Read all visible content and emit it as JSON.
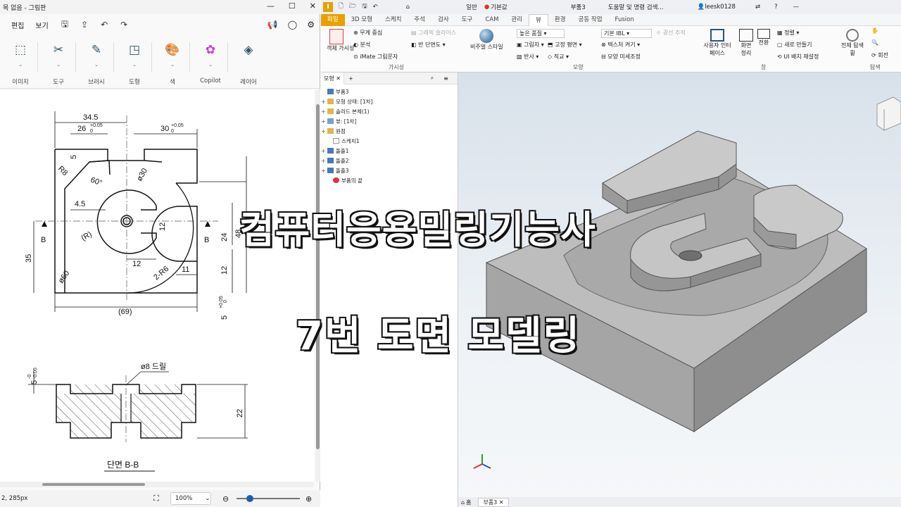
{
  "paint": {
    "window_title": "목 없음 - 그림판",
    "menu": [
      "편집",
      "보기"
    ],
    "ribbon_groups": [
      {
        "label": "이미지",
        "icon": "image-icon"
      },
      {
        "label": "도구",
        "icon": "tools-icon"
      },
      {
        "label": "브러시",
        "icon": "brush-icon"
      },
      {
        "label": "도형",
        "icon": "shapes-icon"
      },
      {
        "label": "색",
        "icon": "palette-icon"
      },
      {
        "label": "Copilot",
        "icon": "copilot-icon"
      },
      {
        "label": "레이어",
        "icon": "layers-icon"
      }
    ],
    "status_pos": "2, 285px",
    "zoom": "100%",
    "drawing": {
      "dims": [
        "34.5",
        "26",
        "+0.05",
        "0",
        "30",
        "+0.05",
        "0",
        "5",
        "R8",
        "60°",
        "ø30",
        "4.5",
        "12",
        "(R)",
        "B",
        "B",
        "35",
        "24",
        "48",
        "ø60",
        "12",
        "2-R6",
        "11",
        "12",
        "(69)",
        "5",
        "+0.05",
        "0"
      ],
      "section_dims": [
        "5",
        "-0",
        "-0.05",
        "ø8 드릴",
        "22"
      ],
      "section_title": "단면 B-B"
    }
  },
  "inventor": {
    "quick_access": [
      "일반",
      "기본값",
      "부품3",
      "도움말 및 명령 검색...",
      "leesk0128"
    ],
    "tabs": [
      "파일",
      "3D 모형",
      "스케치",
      "주석",
      "검사",
      "도구",
      "CAM",
      "관리",
      "뷰",
      "환경",
      "공동 작업",
      "Fusion"
    ],
    "active_tab": "뷰",
    "ribbon": {
      "visibility": {
        "big": "객체 가시성",
        "items": [
          "무게 중심",
          "분석",
          "iMate 그림문자",
          "그래픽 슬라이스",
          "반 단면도"
        ]
      },
      "visibility_label": "가시성",
      "appearance": {
        "big": "비주얼 스타일",
        "items": [
          "높은 품질",
          "그림자",
          "반사",
          "고정 평면",
          "직교",
          "기본 IBL",
          "광선 추적",
          "텍스처 켜기",
          "모양 미세조정"
        ]
      },
      "appearance_label": "모양",
      "windows": {
        "items": [
          "사용자 인터페이스",
          "화면 정리",
          "전환",
          "정렬",
          "새로 만들기",
          "UI 배치 재설정"
        ]
      },
      "windows_label": "창",
      "navigate": {
        "items": [
          "전체 탐색 휠",
          "회전"
        ]
      },
      "navigate_label": "탐색"
    },
    "browser_tab": "모형",
    "tree": [
      {
        "label": "부품3",
        "icon": "part"
      },
      {
        "label": "모형 상태: [1차]",
        "icon": "folder"
      },
      {
        "label": "솔리드 본체(1)",
        "icon": "folder"
      },
      {
        "label": "뷰: [1차]",
        "icon": "view"
      },
      {
        "label": "원점",
        "icon": "folder"
      },
      {
        "label": "스케치1",
        "icon": "sketch"
      },
      {
        "label": "돌출1",
        "icon": "extrude"
      },
      {
        "label": "돌출2",
        "icon": "extrude"
      },
      {
        "label": "돌출3",
        "icon": "extrude"
      },
      {
        "label": "부품의 끝",
        "icon": "end"
      }
    ],
    "doc_tabs": [
      "홈",
      "부품3"
    ]
  },
  "overlay": {
    "line1": "컴퓨터응용밀링기능사",
    "line2": "7번 도면 모델링"
  },
  "colors": {
    "inventor_accent": "#e8a100",
    "paint_accent": "#1a5fb4"
  }
}
